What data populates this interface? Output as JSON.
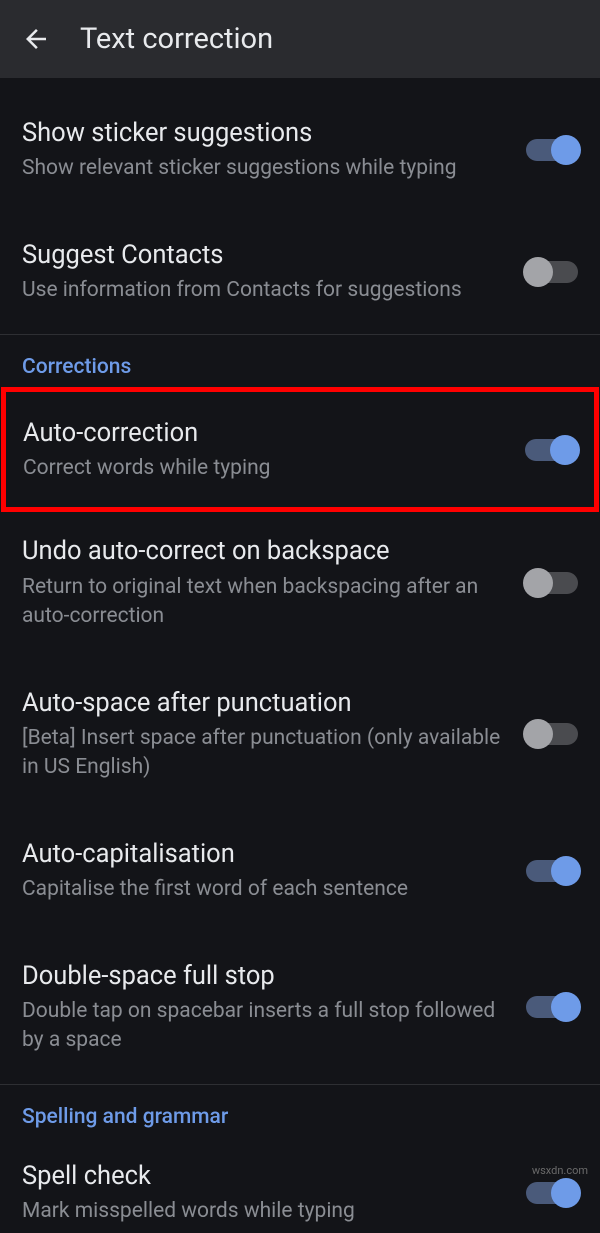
{
  "header": {
    "title": "Text correction"
  },
  "settings": {
    "sticker": {
      "title": "Show sticker suggestions",
      "desc": "Show relevant sticker suggestions while typing",
      "on": true
    },
    "contacts": {
      "title": "Suggest Contacts",
      "desc": "Use information from Contacts for suggestions",
      "on": false
    },
    "autocorrect": {
      "title": "Auto-correction",
      "desc": "Correct words while typing",
      "on": true
    },
    "undo": {
      "title": "Undo auto-correct on backspace",
      "desc": "Return to original text when backspacing after an auto-correction",
      "on": false
    },
    "autospace": {
      "title": "Auto-space after punctuation",
      "desc": "[Beta] Insert space after punctuation (only available in US English)",
      "on": false
    },
    "autocap": {
      "title": "Auto-capitalisation",
      "desc": "Capitalise the first word of each sentence",
      "on": true
    },
    "doublespace": {
      "title": "Double-space full stop",
      "desc": "Double tap on spacebar inserts a full stop followed by a space",
      "on": true
    },
    "spellcheck": {
      "title": "Spell check",
      "desc": "Mark misspelled words while typing",
      "on": true
    }
  },
  "sections": {
    "corrections": "Corrections",
    "spelling": "Spelling and grammar"
  },
  "watermark": "wsxdn.com"
}
